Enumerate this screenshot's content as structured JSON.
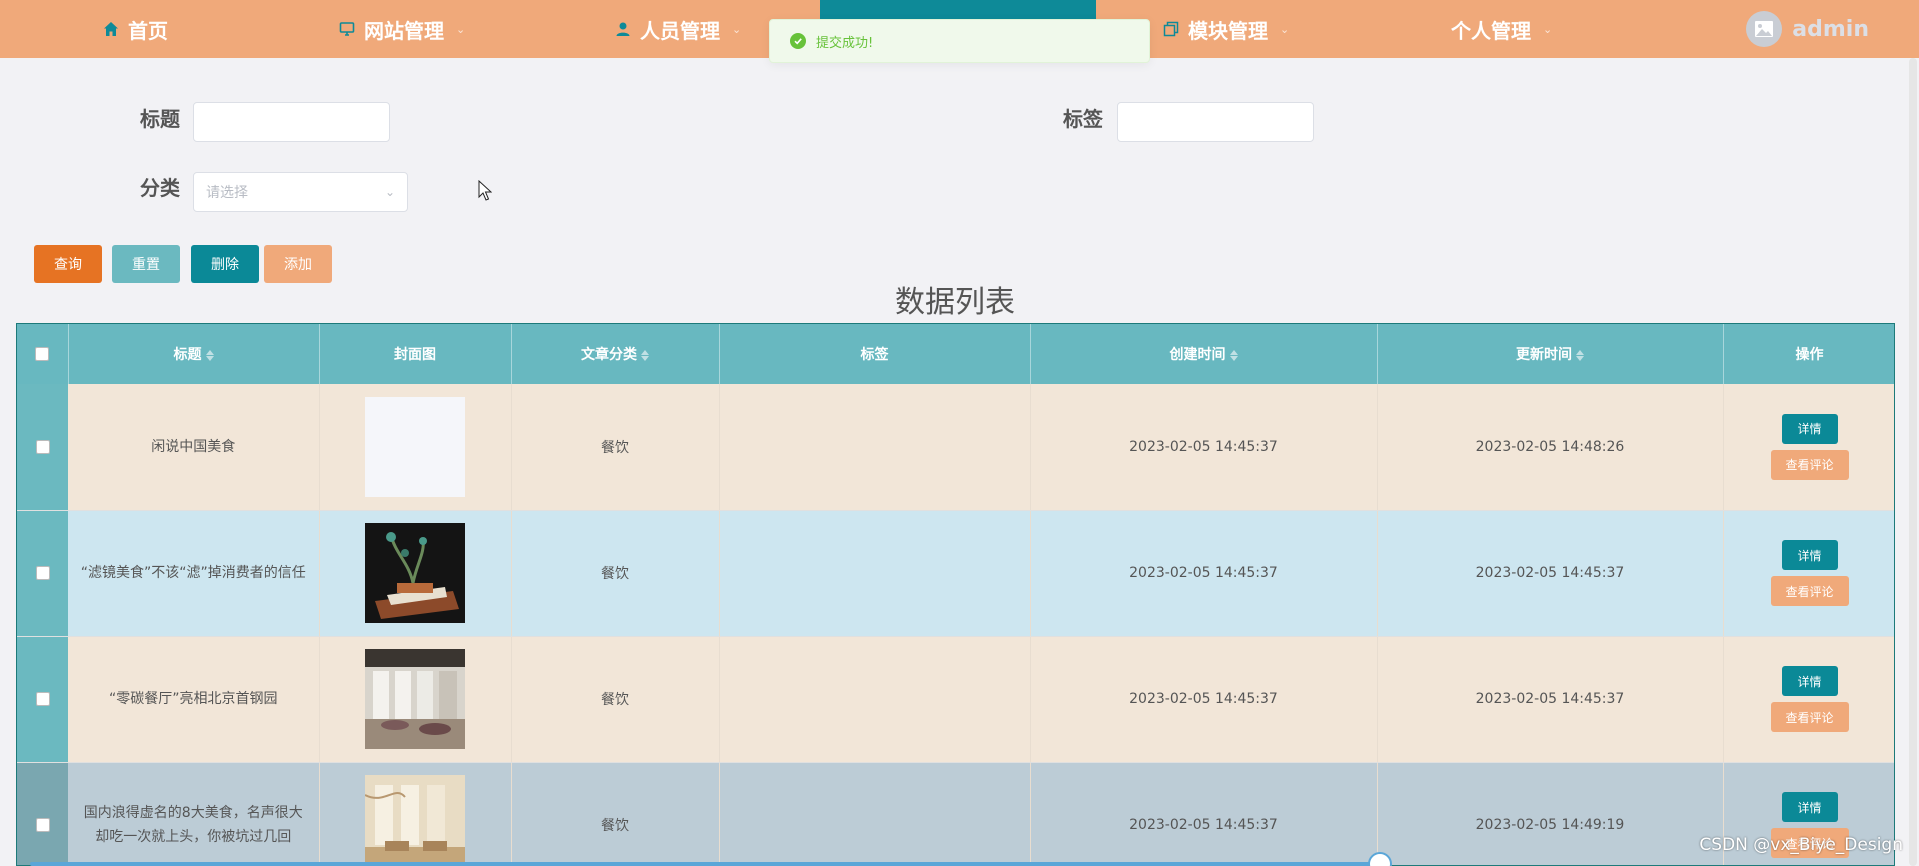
{
  "nav": {
    "items": [
      {
        "label": "首页",
        "icon": "home-icon"
      },
      {
        "label": "网站管理",
        "icon": "monitor-icon"
      },
      {
        "label": "人员管理",
        "icon": "user-icon"
      },
      {
        "label": "模块管理",
        "icon": "copy-icon"
      },
      {
        "label": "个人管理",
        "icon": ""
      }
    ],
    "username": "admin"
  },
  "toast": {
    "message": "提交成功!"
  },
  "search": {
    "title_label": "标题",
    "tag_label": "标签",
    "category_label": "分类",
    "category_placeholder": "请选择"
  },
  "actions": {
    "query": "查询",
    "reset": "重置",
    "delete": "删除",
    "add": "添加"
  },
  "list_title": "数据列表",
  "table": {
    "headers": [
      "标题",
      "封面图",
      "文章分类",
      "标签",
      "创建时间",
      "更新时间",
      "操作"
    ],
    "detail_label": "详情",
    "comment_label": "查看评论",
    "rows": [
      {
        "title": "闲说中国美食",
        "category": "餐饮",
        "tag": "",
        "created": "2023-02-05 14:45:37",
        "updated": "2023-02-05 14:48:26"
      },
      {
        "title": "“滤镜美食”不该“滤”掉消费者的信任",
        "category": "餐饮",
        "tag": "",
        "created": "2023-02-05 14:45:37",
        "updated": "2023-02-05 14:45:37"
      },
      {
        "title": "“零碳餐厅”亮相北京首钢园",
        "category": "餐饮",
        "tag": "",
        "created": "2023-02-05 14:45:37",
        "updated": "2023-02-05 14:45:37"
      },
      {
        "title": "国内浪得虚名的8大美食，名声很大却吃一次就上头，你被坑过几回",
        "category": "餐饮",
        "tag": "",
        "created": "2023-02-05 14:45:37",
        "updated": "2023-02-05 14:49:19"
      }
    ]
  },
  "watermark": "CSDN @vx_Biye_Design",
  "colors": {
    "nav_bg": "#f0a97a",
    "nav_active": "#0e8a98",
    "table_header": "#68b8c0",
    "row_odd": "#f2e6d8",
    "row_even": "#cde6f0",
    "query_btn": "#e67323",
    "reset_btn": "#6bb9c0",
    "delete_btn": "#0b8997",
    "add_btn": "#f0a97a"
  }
}
